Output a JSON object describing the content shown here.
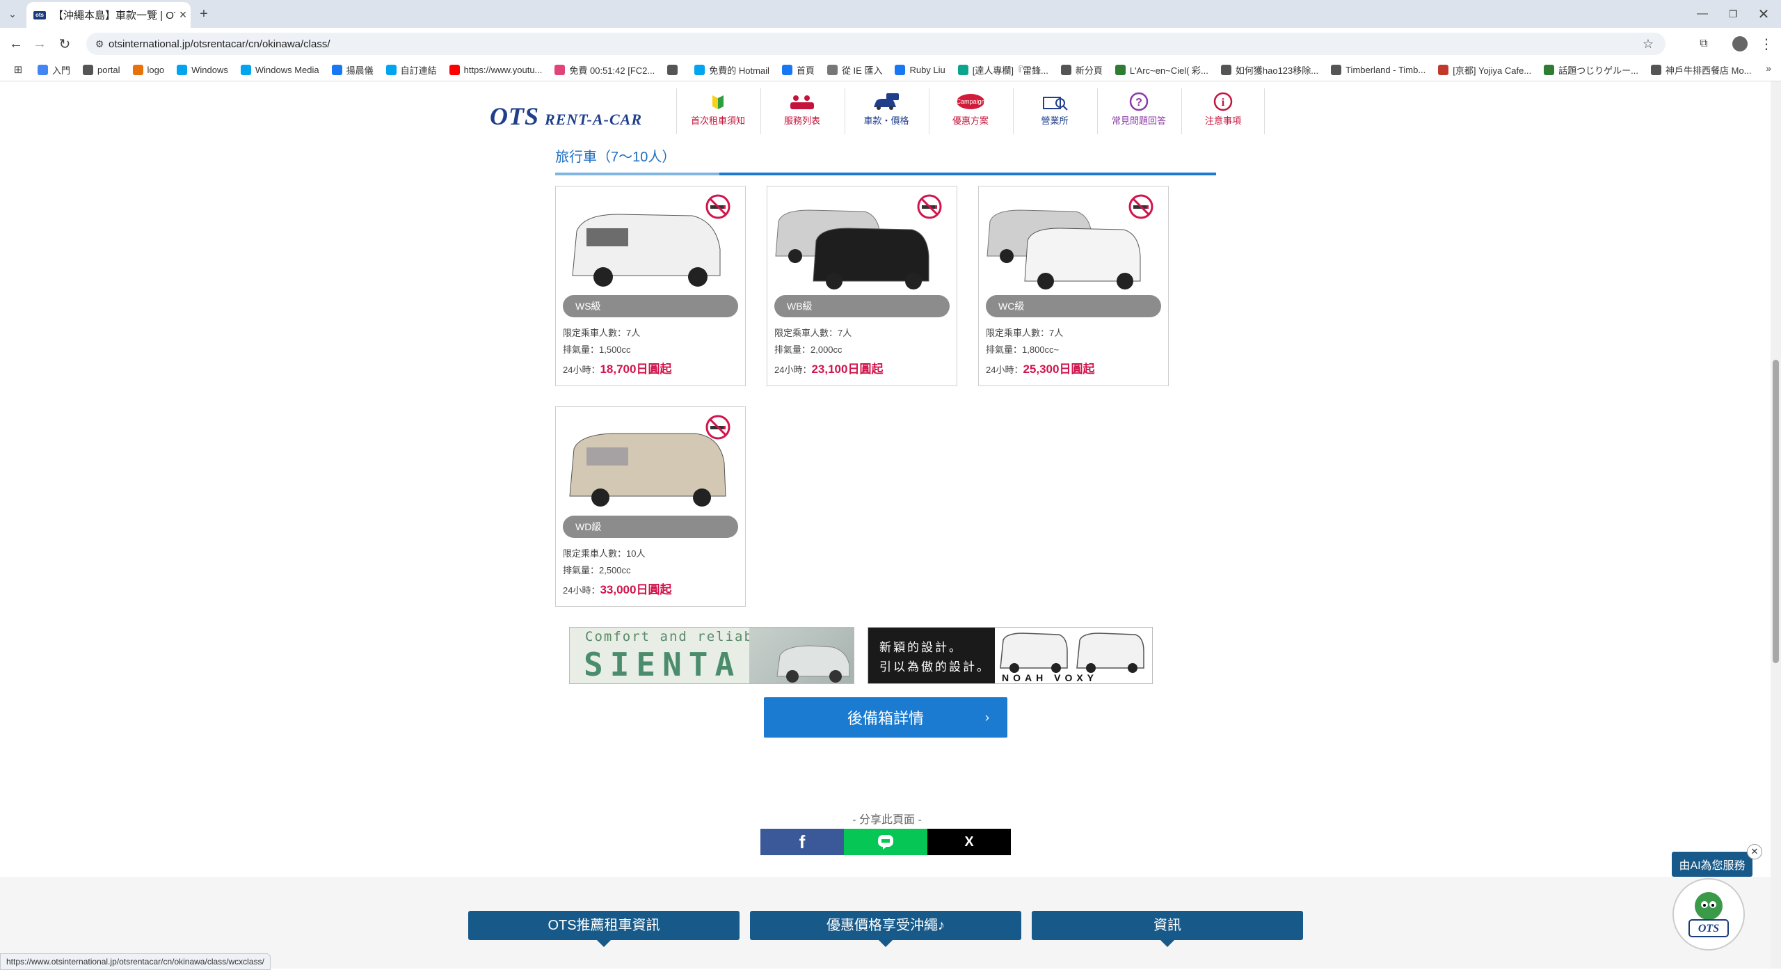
{
  "browser": {
    "tab_title": "【沖繩本島】車款一覽 | OTS租",
    "tab_favicon": "ots",
    "url": "otsinternational.jp/otsrentacar/cn/okinawa/class/",
    "bookmarks": [
      {
        "label": "入門",
        "color": "#4285f4"
      },
      {
        "label": "portal",
        "color": "#555555"
      },
      {
        "label": "logo",
        "color": "#e8710a"
      },
      {
        "label": "Windows",
        "color": "#00a4ef"
      },
      {
        "label": "Windows Media",
        "color": "#00a4ef"
      },
      {
        "label": "揚晨儀",
        "color": "#1877f2"
      },
      {
        "label": "自訂連結",
        "color": "#00a4ef"
      },
      {
        "label": "https://www.youtu...",
        "color": "#ff0000"
      },
      {
        "label": "免費 00:51:42 [FC2...",
        "color": "#e0447a"
      },
      {
        "label": "",
        "color": "#555555"
      },
      {
        "label": "免費的 Hotmail",
        "color": "#00a4ef"
      },
      {
        "label": "首頁",
        "color": "#1877f2"
      },
      {
        "label": "從 IE 匯入",
        "color": "#777777"
      },
      {
        "label": "Ruby Liu",
        "color": "#1877f2"
      },
      {
        "label": "[達人專欄]『雷鋒...",
        "color": "#0aa58c"
      },
      {
        "label": "新分頁",
        "color": "#555555"
      },
      {
        "label": "L'Arc~en~Ciel( 彩...",
        "color": "#2e7d32"
      },
      {
        "label": "如何獲hao123移除...",
        "color": "#555555"
      },
      {
        "label": "Timberland - Timb...",
        "color": "#555555"
      },
      {
        "label": "[京都] Yojiya Cafe...",
        "color": "#c0392b"
      },
      {
        "label": "話題つじりゲルー...",
        "color": "#2e7d32"
      },
      {
        "label": "神戶牛排西餐店 Mo...",
        "color": "#555555"
      }
    ],
    "status_url": "https://www.otsinternational.jp/otsrentacar/cn/okinawa/class/wcxclass/"
  },
  "site": {
    "logo_main": "OTS",
    "logo_sub": "RENT-A-CAR",
    "nav": [
      {
        "label": "首次租車須知",
        "icon": "beginner-leaf-icon"
      },
      {
        "label": "服務列表",
        "icon": "service-list-icon"
      },
      {
        "label": "車款・價格",
        "icon": "car-price-icon"
      },
      {
        "label": "優惠方案",
        "icon": "campaign-icon"
      },
      {
        "label": "營業所",
        "icon": "office-icon"
      },
      {
        "label": "常見問題回答",
        "icon": "question-icon"
      },
      {
        "label": "注意事項",
        "icon": "info-icon"
      }
    ]
  },
  "section": {
    "title": "旅行車（7～10人）"
  },
  "cars": [
    {
      "class": "WS級",
      "capacity": "限定乘車人數：7人",
      "displacement": "排氣量：1,500cc",
      "price_prefix": "24小時：",
      "price": "18,700日圓起",
      "body": "#f0f0f0"
    },
    {
      "class": "WB級",
      "capacity": "限定乘車人數：7人",
      "displacement": "排氣量：2,000cc",
      "price_prefix": "24小時：",
      "price": "23,100日圓起",
      "body": "#1e1e1e"
    },
    {
      "class": "WC級",
      "capacity": "限定乘車人數：7人",
      "displacement": "排氣量：1,800cc~",
      "price_prefix": "24小時：",
      "price": "25,300日圓起",
      "body": "#f4f4f4"
    },
    {
      "class": "WD級",
      "capacity": "限定乘車人數：10人",
      "displacement": "排氣量：2,500cc",
      "price_prefix": "24小時：",
      "price": "33,000日圓起",
      "body": "#d2c8b4"
    }
  ],
  "banners": {
    "sienta_tagline": "Comfort and reliability",
    "sienta_name": "SIENTA",
    "noah_line1": "新穎的設計。",
    "noah_line2": "引以為傲的設計。",
    "noah_name": "NOAH VOXY"
  },
  "buttons": {
    "more": "後備箱詳情"
  },
  "share": {
    "label": "- 分享此頁面 -",
    "facebook": "f",
    "x": "X"
  },
  "footer": {
    "tabs": [
      "OTS推薦租車資訊",
      "優惠價格享受沖繩♪",
      "資訊"
    ]
  },
  "ai_badge": "由AI為您服務",
  "mascot_text": "OTS"
}
